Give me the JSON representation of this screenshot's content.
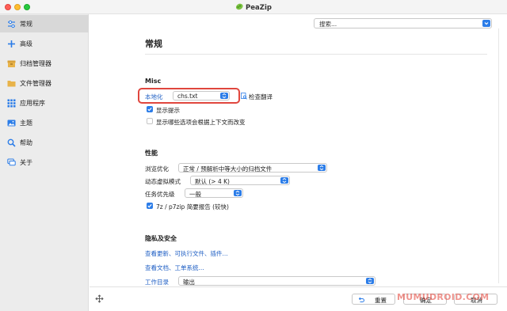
{
  "window": {
    "title": "PeaZip"
  },
  "sidebar": {
    "items": [
      {
        "label": "常规",
        "icon": "sliders-icon"
      },
      {
        "label": "高级",
        "icon": "plus-icon"
      },
      {
        "label": "归档管理器",
        "icon": "archive-icon"
      },
      {
        "label": "文件管理器",
        "icon": "folder-icon"
      },
      {
        "label": "应用程序",
        "icon": "apps-grid-icon"
      },
      {
        "label": "主题",
        "icon": "image-icon"
      },
      {
        "label": "帮助",
        "icon": "search-icon"
      },
      {
        "label": "关于",
        "icon": "chat-icon"
      }
    ]
  },
  "search": {
    "value": "搜索..."
  },
  "page": {
    "title": "常规"
  },
  "misc": {
    "section": "Misc",
    "localization_label": "本地化",
    "localization_value": "chs.txt",
    "check_translation": "检查翻译",
    "show_tips": "显示提示",
    "show_tips_checked": true,
    "context_options": "显示哪些选项会根据上下文而改变",
    "context_options_checked": false
  },
  "performance": {
    "section": "性能",
    "browse_label": "浏览优化",
    "browse_value": "正常 / 预解析中等大小的归档文件",
    "vm_label": "动态虚拟模式",
    "vm_value": "默认 (> 4 K)",
    "priority_label": "任务优先级",
    "priority_value": "一般",
    "report": "7z / p7zip 简要报告 (较快)",
    "report_checked": true
  },
  "privacy": {
    "section": "隐私及安全",
    "updates_link": "查看更新、可执行文件、插件...",
    "docs_link": "查看文档、工单系统...",
    "workdir_label": "工作目录",
    "workdir_value": "输出"
  },
  "footer": {
    "reset_label": "重置",
    "ok_label": "确定",
    "cancel_label": "取消",
    "watermark": "MUMUDROID.COM"
  },
  "colors": {
    "accent": "#2c7de8",
    "link": "#1f5fc4",
    "highlight_box": "#e0463e"
  }
}
